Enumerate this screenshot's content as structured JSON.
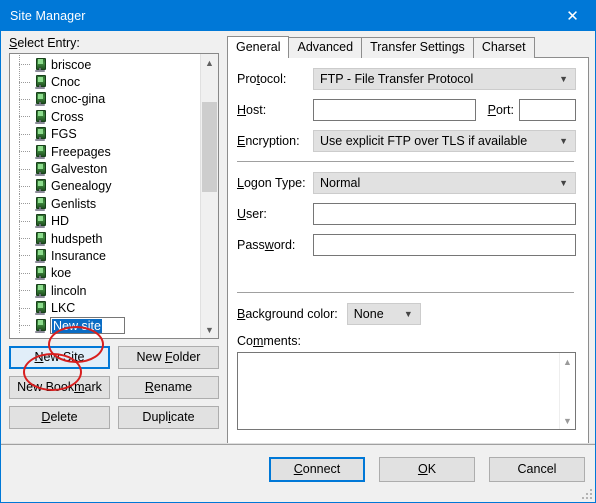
{
  "window": {
    "title": "Site Manager",
    "close_icon": "close-icon",
    "accent_color": "#0078d7",
    "title_bar_color": "#0078d7"
  },
  "left_panel": {
    "select_entry_label": "Select Entry:",
    "tree_items": [
      {
        "label": "briscoe",
        "icon": "server-icon"
      },
      {
        "label": "Cnoc",
        "icon": "server-icon"
      },
      {
        "label": "cnoc-gina",
        "icon": "server-icon"
      },
      {
        "label": "Cross",
        "icon": "server-icon"
      },
      {
        "label": "FGS",
        "icon": "server-icon"
      },
      {
        "label": "Freepages",
        "icon": "server-icon"
      },
      {
        "label": "Galveston",
        "icon": "server-icon"
      },
      {
        "label": "Genealogy",
        "icon": "server-icon"
      },
      {
        "label": "Genlists",
        "icon": "server-icon"
      },
      {
        "label": "HD",
        "icon": "server-icon"
      },
      {
        "label": "hudspeth",
        "icon": "server-icon"
      },
      {
        "label": "Insurance",
        "icon": "server-icon"
      },
      {
        "label": "koe",
        "icon": "server-icon"
      },
      {
        "label": "lincoln",
        "icon": "server-icon"
      },
      {
        "label": "LKC",
        "icon": "server-icon"
      },
      {
        "label": "New site",
        "icon": "server-icon",
        "editing": true,
        "selected_text": "New site"
      }
    ],
    "scrollbar": {
      "up_icon": "chevron-up-icon",
      "down_icon": "chevron-down-icon"
    },
    "buttons": [
      {
        "label": "New Site",
        "accel": "N",
        "focused": true
      },
      {
        "label": "New Folder",
        "accel": "F",
        "focused": false
      },
      {
        "label": "New Bookmark",
        "accel": "m",
        "focused": false
      },
      {
        "label": "Rename",
        "accel": "R",
        "focused": false
      },
      {
        "label": "Delete",
        "accel": "D",
        "focused": false
      },
      {
        "label": "Duplicate",
        "accel": "i",
        "focused": false
      }
    ]
  },
  "right_panel": {
    "tabs": [
      {
        "label": "General",
        "active": true
      },
      {
        "label": "Advanced",
        "active": false
      },
      {
        "label": "Transfer Settings",
        "active": false
      },
      {
        "label": "Charset",
        "active": false
      }
    ],
    "fields": {
      "protocol_label": "Protocol:",
      "protocol_value": "FTP - File Transfer Protocol",
      "host_label": "Host:",
      "host_value": "",
      "port_label": "Port:",
      "port_value": "",
      "encryption_label": "Encryption:",
      "encryption_value": "Use explicit FTP over TLS if available",
      "logon_type_label": "Logon Type:",
      "logon_type_value": "Normal",
      "user_label": "User:",
      "user_value": "",
      "password_label": "Password:",
      "password_value": "",
      "background_color_label": "Background color:",
      "background_color_value": "None",
      "comments_label": "Comments:",
      "comments_value": ""
    },
    "chevron_icon": "chevron-down-icon"
  },
  "footer": {
    "buttons": [
      {
        "label": "Connect",
        "accel": "C",
        "default": true
      },
      {
        "label": "OK",
        "accel": "O",
        "default": false
      },
      {
        "label": "Cancel",
        "accel": "",
        "default": false
      }
    ],
    "resize_grip": "resize-grip-icon"
  },
  "annotations": {
    "color": "#d81f1f",
    "circles": [
      {
        "name": "new-site-tree-entry-highlight"
      },
      {
        "name": "new-site-button-highlight"
      }
    ]
  }
}
